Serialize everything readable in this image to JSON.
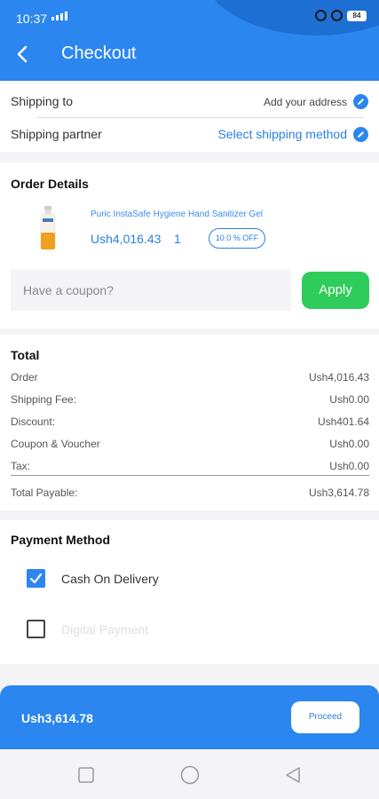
{
  "status_bar": {
    "time": "10:37",
    "battery": "84"
  },
  "header": {
    "title": "Checkout"
  },
  "shipping": {
    "shipping_to_label": "Shipping to",
    "shipping_to_value": "Add your address",
    "partner_label": "Shipping partner",
    "partner_value": "Select shipping method"
  },
  "order_details": {
    "title": "Order Details",
    "product": {
      "name": "Puric InstaSafe Hygiene Hand Sanitizer Gel",
      "price": "Ush4,016.43",
      "quantity": "1",
      "discount_badge": "10.0 % OFF"
    },
    "coupon_placeholder": "Have a coupon?",
    "apply_label": "Apply"
  },
  "total": {
    "title": "Total",
    "rows": [
      {
        "label": "Order",
        "value": "Ush4,016.43"
      },
      {
        "label": "Shipping Fee:",
        "value": "Ush0.00"
      },
      {
        "label": "Discount:",
        "value": "Ush401.64"
      },
      {
        "label": "Coupon & Voucher",
        "value": "Ush0.00"
      },
      {
        "label": "Tax:",
        "value": "Ush0.00"
      }
    ],
    "payable_label": "Total Payable:",
    "payable_value": "Ush3,614.78"
  },
  "payment": {
    "title": "Payment Method",
    "options": [
      {
        "label": "Cash On Delivery",
        "checked": true
      },
      {
        "label": "Digital Payment",
        "checked": false
      }
    ]
  },
  "bottom_bar": {
    "total": "Ush3,614.78",
    "proceed_label": "Proceed"
  },
  "colors": {
    "primary": "#2b86f0",
    "apply_green": "#2ecc5a",
    "link_blue": "#2b7fe6"
  }
}
